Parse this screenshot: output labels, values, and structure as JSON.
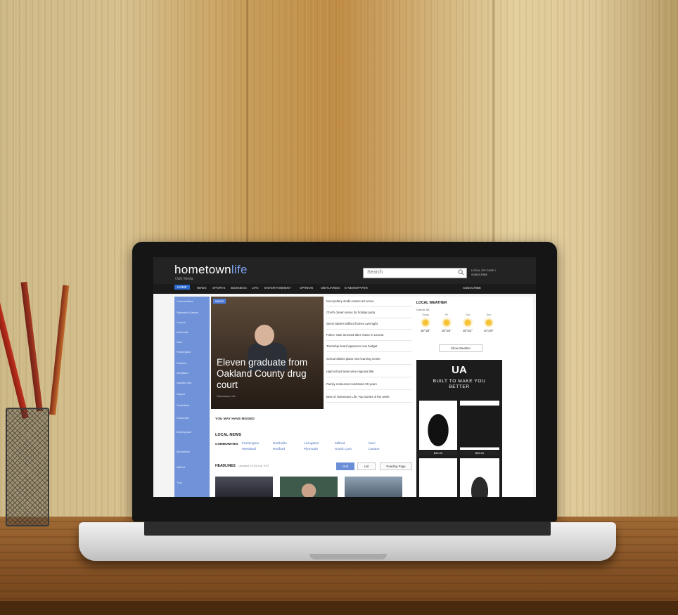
{
  "site": {
    "logo_main": "hometown",
    "logo_accent": "life",
    "logo_sub": "O&E Media",
    "search_placeholder": "Search",
    "header_promo": "LOCAL ZIP CODE / SUBSCRIBE"
  },
  "nav": {
    "items": [
      "HOME",
      "NEWS",
      "SPORTS",
      "BUSINESS",
      "LIFE",
      "ENTERTAINMENT",
      "OPINION",
      "OBITUARIES",
      "E-NEWSPAPER",
      "SUBSCRIBE"
    ]
  },
  "sidebar": {
    "items": [
      "Communities",
      "Plymouth-Canton",
      "Livonia",
      "Northville",
      "Novi",
      "Farmington",
      "Redford",
      "Westland",
      "Garden City",
      "Wayne",
      "Southfield",
      "Rochester",
      "Birmingham",
      "Bloomfield",
      "Milford",
      "Troy"
    ]
  },
  "hero": {
    "badge": "NEWS",
    "title": "Eleven graduate from Oakland County drug court",
    "meta": "Hometown Life"
  },
  "headlines": [
    "Novi pottery studio enters art scene",
    "Chef’s dream menu for holiday party",
    "Storm batters Milford homes overnight",
    "Police: Man arrested after chase in Livonia",
    "Township board approves new budget",
    "School district plans new learning center",
    "High school team wins regional title",
    "Family restaurant celebrates 50 years",
    "Best of Hometown Life: Top stories of the week"
  ],
  "sections": {
    "shared_label": "YOU MAY HAVE MISSED",
    "local_news": "LOCAL NEWS",
    "communities_label": "COMMUNITIES",
    "communities": [
      "Farmington",
      "Westland",
      "Northville",
      "Redford",
      "Livingston",
      "Plymouth",
      "Milford",
      "South Lyon",
      "Novi",
      "Canton"
    ],
    "headlines_label": "HEADLINES",
    "updated": "Updated 10:15 a.m. EST",
    "btn_grid": "Grid",
    "btn_list": "List",
    "btn_reading": "Reading Page"
  },
  "weather": {
    "title": "LOCAL WEATHER",
    "location": "Detroit, MI",
    "days": [
      {
        "day": "Today",
        "temp": "38°/28°"
      },
      {
        "day": "Fri",
        "temp": "35°/24°"
      },
      {
        "day": "Sat",
        "temp": "36°/22°"
      },
      {
        "day": "Sun",
        "temp": "40°/29°"
      }
    ],
    "button": "Show Weather"
  },
  "ad": {
    "logo": "UA",
    "tagline": "BUILT TO MAKE YOU BETTER",
    "prices": [
      "$25.00",
      "$35.00"
    ]
  }
}
